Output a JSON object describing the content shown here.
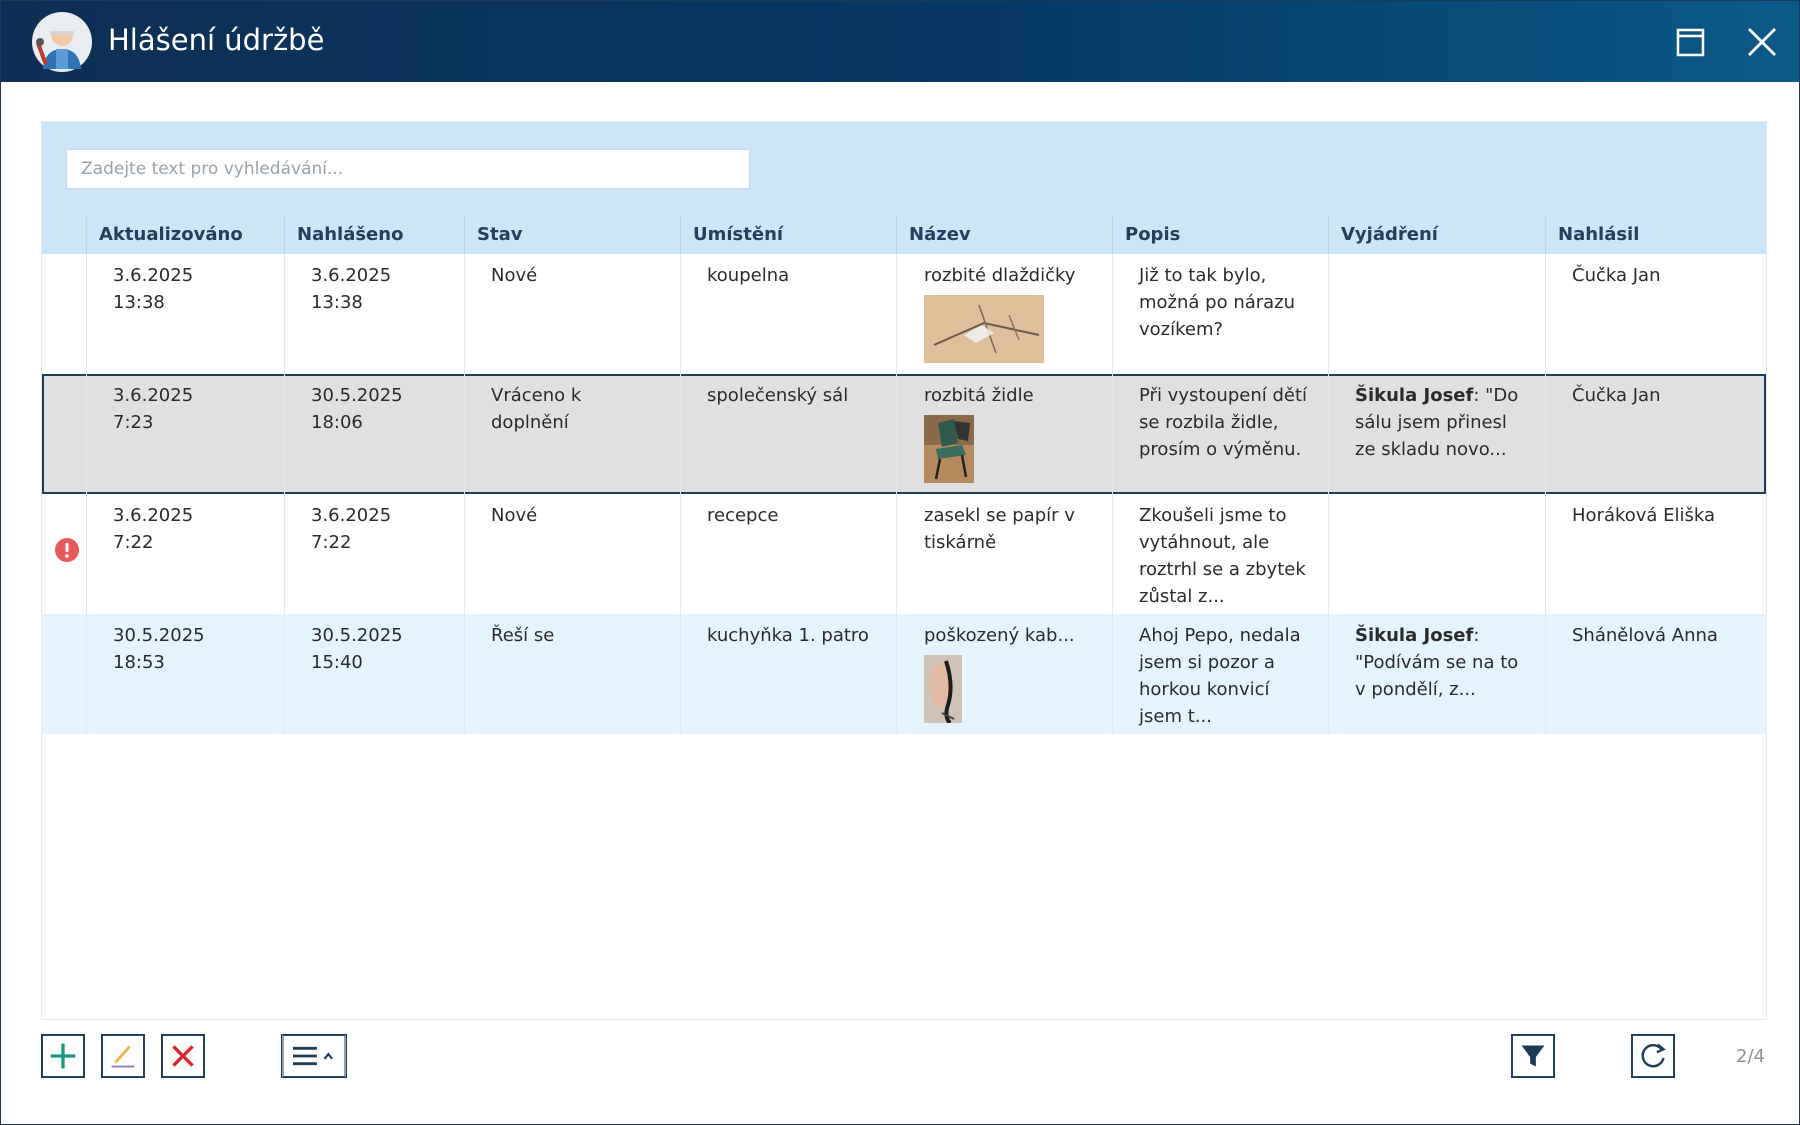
{
  "window": {
    "title": "Hlášení údržbě"
  },
  "search": {
    "placeholder": "Zadejte text pro vyhledávání..."
  },
  "columns": [
    "Aktualizováno",
    "Nahlášeno",
    "Stav",
    "Umístění",
    "Název",
    "Popis",
    "Vyjádření",
    "Nahlásil"
  ],
  "rows": [
    {
      "updated_date": "3.6.2025",
      "updated_time": "13:38",
      "reported_date": "3.6.2025",
      "reported_time": "13:38",
      "status_line1": "Nové",
      "status_line2": "",
      "location": "koupelna",
      "name": "rozbité dlaždičky",
      "description_lines": [
        "Již to tak bylo,",
        "možná po nárazu",
        "vozíkem?",
        ""
      ],
      "response_author": "",
      "response_lines": [
        "",
        "",
        ""
      ],
      "reporter": "Čučka Jan"
    },
    {
      "updated_date": "3.6.2025",
      "updated_time": "7:23",
      "reported_date": "30.5.2025",
      "reported_time": "18:06",
      "status_line1": "Vráceno k",
      "status_line2": "doplnění",
      "location": "společenský sál",
      "name": "rozbitá židle",
      "description_lines": [
        "Při vystoupení dětí",
        "se rozbila židle,",
        "prosím o výměnu.",
        ""
      ],
      "response_author": "Šikula Josef",
      "response_lines": [
        ": \"Do",
        "sálu jsem přinesl",
        "ze skladu novo..."
      ],
      "reporter": "Čučka Jan"
    },
    {
      "updated_date": "3.6.2025",
      "updated_time": "7:22",
      "reported_date": "3.6.2025",
      "reported_time": "7:22",
      "status_line1": "Nové",
      "status_line2": "",
      "location": "recepce",
      "name": "zasekl se papír v tiskárně",
      "description_lines": [
        "Zkoušeli jsme to",
        "vytáhnout, ale",
        "roztrhl se a zbytek",
        "zůstal z..."
      ],
      "response_author": "",
      "response_lines": [
        "",
        "",
        ""
      ],
      "reporter": "Horáková Eliška"
    },
    {
      "updated_date": "30.5.2025",
      "updated_time": "18:53",
      "reported_date": "30.5.2025",
      "reported_time": "15:40",
      "status_line1": "Řeší se",
      "status_line2": "",
      "location": "kuchyňka 1. patro",
      "name": "poškozený kab...",
      "description_lines": [
        "Ahoj Pepo, nedala",
        "jsem si pozor a",
        "horkou konvicí",
        "jsem t..."
      ],
      "response_author": "Šikula Josef",
      "response_lines": [
        ":",
        "\"Podívám se na to",
        "v pondělí, z..."
      ],
      "reporter": "Shánělová Anna"
    }
  ],
  "pager": {
    "text": "2/4"
  },
  "colors": {
    "titlebar": "#0d2f54",
    "header_bg": "#cbe6f6",
    "selected_row": "#e0e0e0",
    "alt_row": "#e4f3fc",
    "add": "#1a9b7f",
    "delete": "#d9232d",
    "error": "#e85a5a"
  },
  "icons": [
    "technician-avatar-icon",
    "maximize-icon",
    "close-icon",
    "error-icon",
    "add-icon",
    "edit-icon",
    "delete-icon",
    "menu-icon",
    "filter-icon",
    "refresh-icon"
  ]
}
